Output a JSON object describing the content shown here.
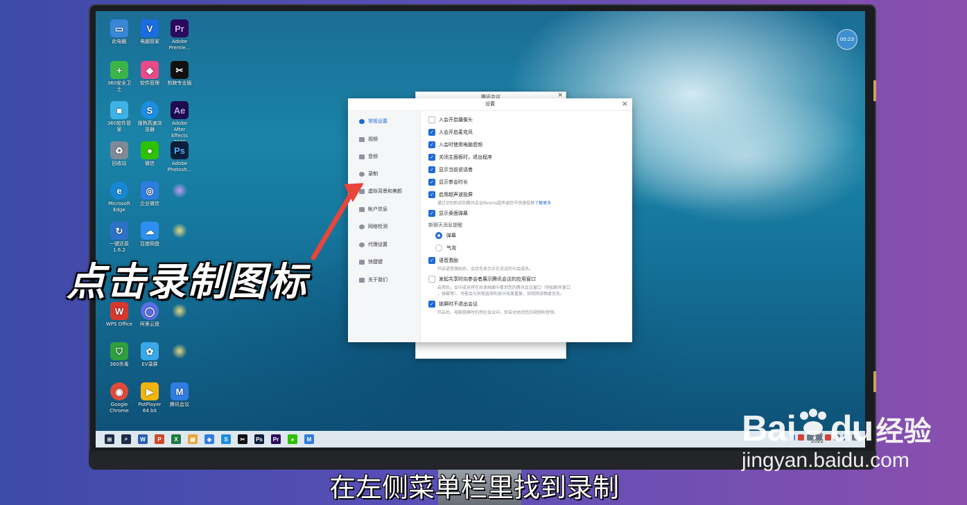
{
  "desktop": {
    "icons": [
      {
        "label": "此电脑",
        "glyph": "▭",
        "color": "#3a86d8"
      },
      {
        "label": "电脑管家",
        "glyph": "V",
        "color": "#1a6de0"
      },
      {
        "label": "Adobe Premie...",
        "glyph": "Pr",
        "color": "#2a0a5e"
      },
      {
        "label": "360安全卫士",
        "glyph": "+",
        "color": "#3bb54a"
      },
      {
        "label": "软件管理",
        "glyph": "◆",
        "color": "#e84a8a"
      },
      {
        "label": "剪映专业版",
        "glyph": "✂",
        "color": "#111111"
      },
      {
        "label": "360软件管家",
        "glyph": "■",
        "color": "#3fb2e5"
      },
      {
        "label": "搜狗高速浏览器",
        "glyph": "S",
        "color": "#1c8de0"
      },
      {
        "label": "Adobe After Effects 2020",
        "glyph": "Ae",
        "color": "#1d0b4e"
      },
      {
        "label": "回收站",
        "glyph": "♻",
        "color": "#7f8a96"
      },
      {
        "label": "微信",
        "glyph": "●",
        "color": "#2dc100"
      },
      {
        "label": "Adobe Photosh...",
        "glyph": "Ps",
        "color": "#0b1e3a"
      },
      {
        "label": "Microsoft Edge",
        "glyph": "e",
        "color": "#1787d5"
      },
      {
        "label": "企业微信",
        "glyph": "◎",
        "color": "#2f7de1"
      },
      {
        "label": "一键还原 1.6.2",
        "glyph": "↻",
        "color": "#2d72c6"
      },
      {
        "label": "百度网盘",
        "glyph": "☁",
        "color": "#2f8ff0"
      },
      {
        "label": "WPS Office",
        "glyph": "W",
        "color": "#d8382e"
      },
      {
        "label": "阿里云盘",
        "glyph": "◯",
        "color": "#5a6ee8"
      },
      {
        "label": "360杀毒",
        "glyph": "⛉",
        "color": "#2f9e3e"
      },
      {
        "label": "EV录屏",
        "glyph": "✿",
        "color": "#3aa8e8"
      },
      {
        "label": "Google Chrome",
        "glyph": "◉",
        "color": "#e04a3a"
      },
      {
        "label": "PotPlayer 64 bit",
        "glyph": "▶",
        "color": "#f2b40e"
      },
      {
        "label": "腾讯会议",
        "glyph": "M",
        "color": "#2f7de1"
      }
    ],
    "timer_badge": "00:23"
  },
  "taskbar": {
    "apps": [
      {
        "glyph": "⊞",
        "color": "#1b2d44"
      },
      {
        "glyph": "⌕",
        "color": "#1b2d44"
      },
      {
        "glyph": "W",
        "color": "#2b5fb4"
      },
      {
        "glyph": "P",
        "color": "#cf4a2a"
      },
      {
        "glyph": "X",
        "color": "#1e7a43"
      },
      {
        "glyph": "▤",
        "color": "#e8a63a"
      },
      {
        "glyph": "◆",
        "color": "#2f7de1"
      },
      {
        "glyph": "S",
        "color": "#1c8de0"
      },
      {
        "glyph": "✂",
        "color": "#111111"
      },
      {
        "glyph": "Ps",
        "color": "#0b1e3a"
      },
      {
        "glyph": "Pr",
        "color": "#2a0a5e"
      },
      {
        "glyph": "●",
        "color": "#2dc100"
      },
      {
        "glyph": "M",
        "color": "#2f7de1"
      }
    ],
    "clock_time": "18:0",
    "clock_date": "2022"
  },
  "meeting_window": {
    "title": "腾讯会议"
  },
  "settings": {
    "title": "设置",
    "nav": [
      {
        "label": "常规设置",
        "active": true
      },
      {
        "label": "视频",
        "active": false
      },
      {
        "label": "音频",
        "active": false
      },
      {
        "label": "录制",
        "active": false
      },
      {
        "label": "虚拟背景和美颜",
        "active": false
      },
      {
        "label": "帐户信息",
        "active": false
      },
      {
        "label": "网络检测",
        "active": false
      },
      {
        "label": "代理设置",
        "active": false
      },
      {
        "label": "快捷键",
        "active": false
      },
      {
        "label": "关于我们",
        "active": false
      }
    ],
    "options": [
      {
        "label": "入会开启摄像头",
        "checked": false
      },
      {
        "label": "入会开启麦克风",
        "checked": true
      },
      {
        "label": "入会时使用电脑音频",
        "checked": true
      },
      {
        "label": "关闭主面板时，退出程序",
        "checked": true
      },
      {
        "label": "显示当前说话者",
        "checked": true
      },
      {
        "label": "显示参会时长",
        "checked": true
      },
      {
        "label": "启用超声波投屏",
        "checked": true
      },
      {
        "label": "显示桌面弹幕",
        "checked": true
      }
    ],
    "ultrasonic_hint": "通过识别附近的腾讯会议Rooms超声波信号快速投屏",
    "learn_more": "了解更多",
    "chat_reminder_label": "新聊天消息提醒",
    "chat_options": [
      {
        "label": "弹幕",
        "selected": true
      },
      {
        "label": "气泡",
        "selected": false
      }
    ],
    "voice_excitation": {
      "label": "语音激励",
      "checked": true,
      "hint": "开启语音激励后，会优先显示正在说话的与会成员。"
    },
    "share_window": {
      "label": "发起共享时向参会者展示腾讯会议的应用窗口",
      "checked": false,
      "hint1": "启用后，会中成员将在共享画面中看到您的腾讯会议窗口（例如聊天窗口",
      "hint2": "，弹幕等），可能会与其他选项的部分效果重复，如视频流畅度优先。"
    },
    "lock_screen": {
      "label": "锁屏时不退出会议",
      "checked": true,
      "hint": "开启后，电脑锁屏时仍然在会议中，但自动关闭您的视频和音频。"
    }
  },
  "overlay": {
    "caption_main": "点击录制图标",
    "caption_sub": "在左侧菜单栏里找到录制",
    "watermark_logo_left": "Bai",
    "watermark_logo_right": "du",
    "watermark_suffix": "经验",
    "watermark_url": "jingyan.baidu.com"
  }
}
